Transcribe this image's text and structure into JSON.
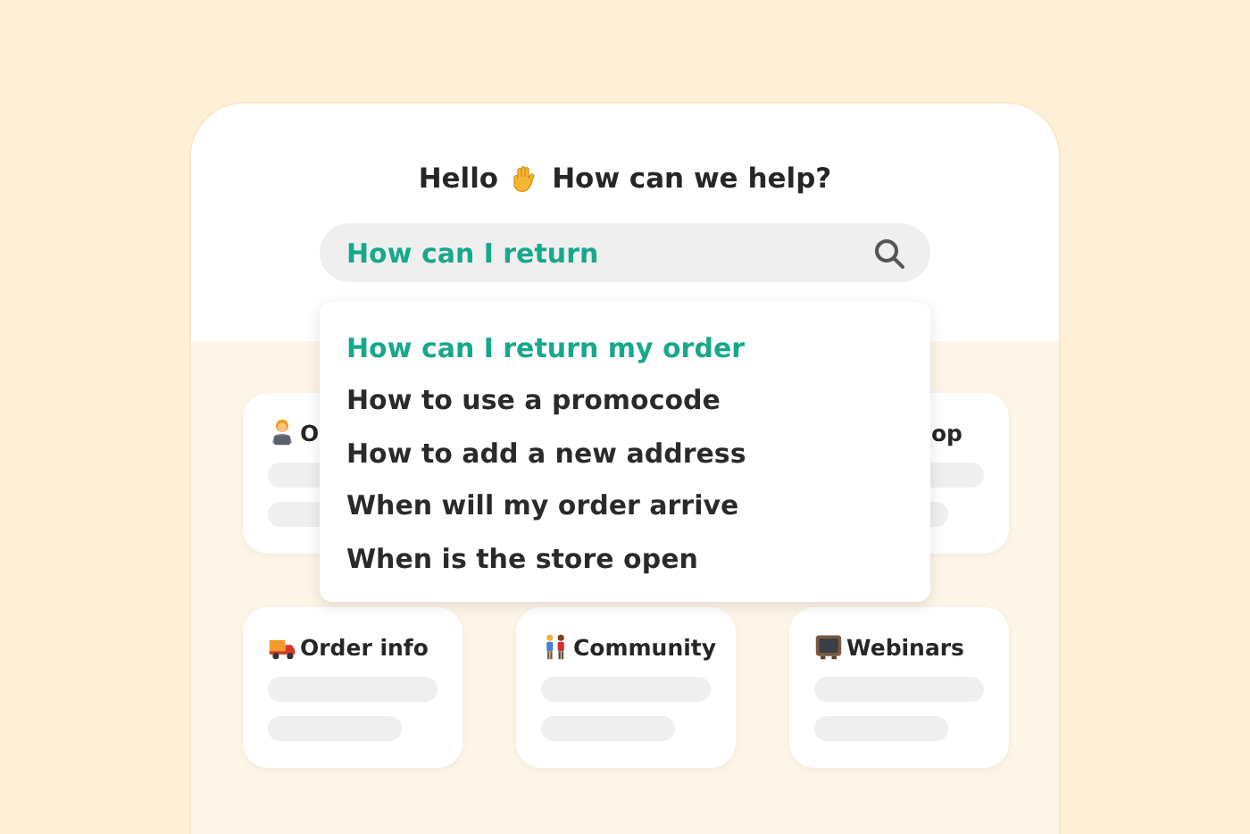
{
  "greeting": {
    "before": "Hello",
    "after": "How can we help?"
  },
  "search": {
    "value": "How can I return"
  },
  "suggestions": [
    {
      "text": "How can I return my order",
      "selected": true
    },
    {
      "text": "How to use a promocode",
      "selected": false
    },
    {
      "text": "How to add a new address",
      "selected": false
    },
    {
      "text": "When will my order arrive",
      "selected": false
    },
    {
      "text": "When is the store open",
      "selected": false
    }
  ],
  "card_rows": [
    {
      "cards": [
        {
          "kind": "laptop",
          "title": "O"
        },
        {
          "title": "op"
        }
      ]
    },
    {
      "cards": [
        {
          "kind": "truck",
          "title": "Order info"
        },
        {
          "kind": "couple",
          "title": "Community"
        },
        {
          "kind": "tv",
          "title": "Webinars"
        }
      ]
    }
  ]
}
